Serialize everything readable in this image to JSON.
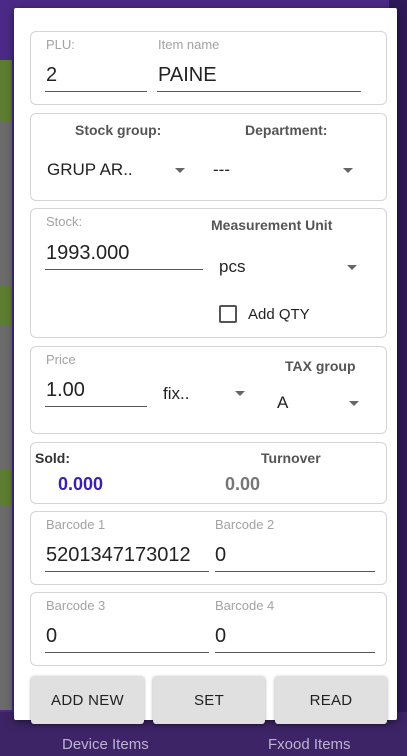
{
  "background": {
    "bottom_left": "Device Items",
    "bottom_right": "Fxood Items"
  },
  "plu_card": {
    "plu_label": "PLU:",
    "plu_value": "2",
    "name_label": "Item name",
    "name_value": "PAINE"
  },
  "group_card": {
    "stock_group_label": "Stock group:",
    "stock_group_value": "GRUP AR..",
    "department_label": "Department:",
    "department_value": "---"
  },
  "stock_card": {
    "stock_label": "Stock:",
    "stock_value": "1993.000",
    "unit_label": "Measurement Unit",
    "unit_value": "pcs",
    "add_qty_label": "Add QTY"
  },
  "price_card": {
    "price_label": "Price",
    "price_value": "1.00",
    "price_type": "fix..",
    "tax_label": "TAX group",
    "tax_value": "A"
  },
  "sold_card": {
    "sold_label": "Sold:",
    "sold_value": "0.000",
    "turnover_label": "Turnover",
    "turnover_value": "0.00"
  },
  "barcode_card_1": {
    "b1_label": "Barcode 1",
    "b1_value": "5201347173012",
    "b2_label": "Barcode 2",
    "b2_value": "0"
  },
  "barcode_card_2": {
    "b3_label": "Barcode 3",
    "b3_value": "0",
    "b4_label": "Barcode 4",
    "b4_value": "0"
  },
  "buttons": {
    "add_new": "ADD NEW",
    "set": "SET",
    "read": "READ"
  },
  "colors": {
    "sold_value": "#3a1fb0",
    "background": "#4a2a86"
  }
}
